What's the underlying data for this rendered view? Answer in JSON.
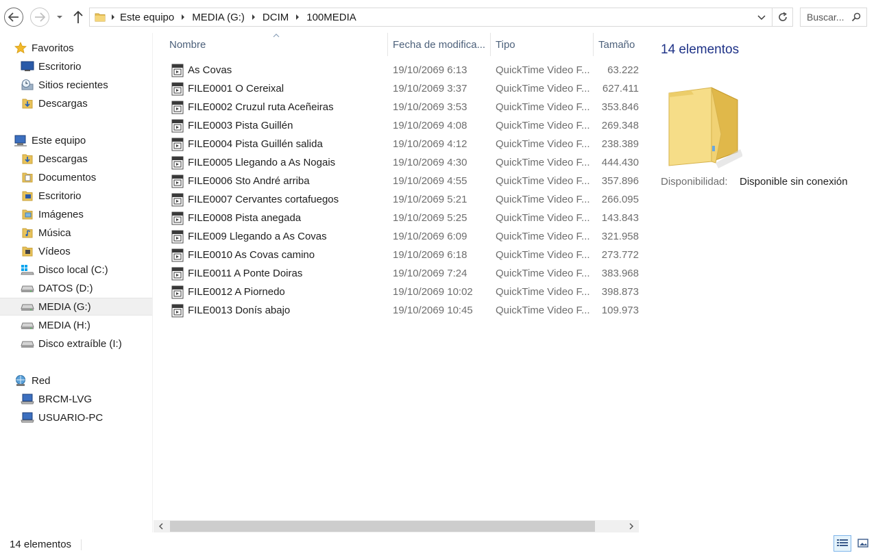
{
  "nav": {
    "breadcrumbs": [
      "Este equipo",
      "MEDIA (G:)",
      "DCIM",
      "100MEDIA"
    ],
    "search_placeholder": "Buscar..."
  },
  "sidebar": {
    "favorites": {
      "label": "Favoritos",
      "items": [
        {
          "label": "Escritorio",
          "icon": "desktop-icon"
        },
        {
          "label": "Sitios recientes",
          "icon": "recent-places-icon"
        },
        {
          "label": "Descargas",
          "icon": "downloads-icon"
        }
      ]
    },
    "computer": {
      "label": "Este equipo",
      "items": [
        {
          "label": "Descargas",
          "icon": "downloads-folder-icon"
        },
        {
          "label": "Documentos",
          "icon": "documents-folder-icon"
        },
        {
          "label": "Escritorio",
          "icon": "desktop-folder-icon"
        },
        {
          "label": "Imágenes",
          "icon": "pictures-folder-icon"
        },
        {
          "label": "Música",
          "icon": "music-folder-icon"
        },
        {
          "label": "Vídeos",
          "icon": "videos-folder-icon"
        },
        {
          "label": "Disco local (C:)",
          "icon": "system-drive-icon"
        },
        {
          "label": "DATOS (D:)",
          "icon": "drive-icon"
        },
        {
          "label": "MEDIA (G:)",
          "icon": "drive-icon",
          "selected": true
        },
        {
          "label": "MEDIA (H:)",
          "icon": "drive-icon"
        },
        {
          "label": "Disco extraíble (I:)",
          "icon": "removable-drive-icon"
        }
      ]
    },
    "network": {
      "label": "Red",
      "items": [
        {
          "label": "BRCM-LVG",
          "icon": "network-computer-icon"
        },
        {
          "label": "USUARIO-PC",
          "icon": "network-computer-icon"
        }
      ]
    }
  },
  "columns": {
    "name": "Nombre",
    "date": "Fecha de modifica...",
    "type": "Tipo",
    "size": "Tamaño"
  },
  "files": [
    {
      "name": "As Covas",
      "date": "19/10/2069 6:13",
      "type": "QuickTime Video F...",
      "size": "63.222"
    },
    {
      "name": "FILE0001 O Cereixal",
      "date": "19/10/2069 3:37",
      "type": "QuickTime Video F...",
      "size": "627.411"
    },
    {
      "name": "FILE0002 Cruzul ruta Aceñeiras",
      "date": "19/10/2069 3:53",
      "type": "QuickTime Video F...",
      "size": "353.846"
    },
    {
      "name": "FILE0003 Pista Guillén",
      "date": "19/10/2069 4:08",
      "type": "QuickTime Video F...",
      "size": "269.348"
    },
    {
      "name": "FILE0004 Pista Guillén salida",
      "date": "19/10/2069 4:12",
      "type": "QuickTime Video F...",
      "size": "238.389"
    },
    {
      "name": "FILE0005 Llegando a As Nogais",
      "date": "19/10/2069 4:30",
      "type": "QuickTime Video F...",
      "size": "444.430"
    },
    {
      "name": "FILE0006 Sto André arriba",
      "date": "19/10/2069 4:55",
      "type": "QuickTime Video F...",
      "size": "357.896"
    },
    {
      "name": "FILE0007 Cervantes cortafuegos",
      "date": "19/10/2069 5:21",
      "type": "QuickTime Video F...",
      "size": "266.095"
    },
    {
      "name": "FILE0008 Pista anegada",
      "date": "19/10/2069 5:25",
      "type": "QuickTime Video F...",
      "size": "143.843"
    },
    {
      "name": "FILE009 Llegando a As Covas",
      "date": "19/10/2069 6:09",
      "type": "QuickTime Video F...",
      "size": "321.958"
    },
    {
      "name": "FILE0010 As  Covas camino",
      "date": "19/10/2069 6:18",
      "type": "QuickTime Video F...",
      "size": "273.772"
    },
    {
      "name": "FILE0011 A Ponte Doiras",
      "date": "19/10/2069 7:24",
      "type": "QuickTime Video F...",
      "size": "383.968"
    },
    {
      "name": "FILE0012 A Piornedo",
      "date": "19/10/2069 10:02",
      "type": "QuickTime Video F...",
      "size": "398.873"
    },
    {
      "name": "FILE0013 Donís abajo",
      "date": "19/10/2069 10:45",
      "type": "QuickTime Video F...",
      "size": "109.973"
    }
  ],
  "details": {
    "count": "14 elementos",
    "availability_label": "Disponibilidad:",
    "availability_value": "Disponible sin conexión"
  },
  "status": {
    "count": "14 elementos"
  },
  "colors": {
    "accent": "#1e3287",
    "header_text": "#4c607a",
    "secondary_text": "#6d6d6d",
    "selected_bg": "#f0f0f0"
  }
}
